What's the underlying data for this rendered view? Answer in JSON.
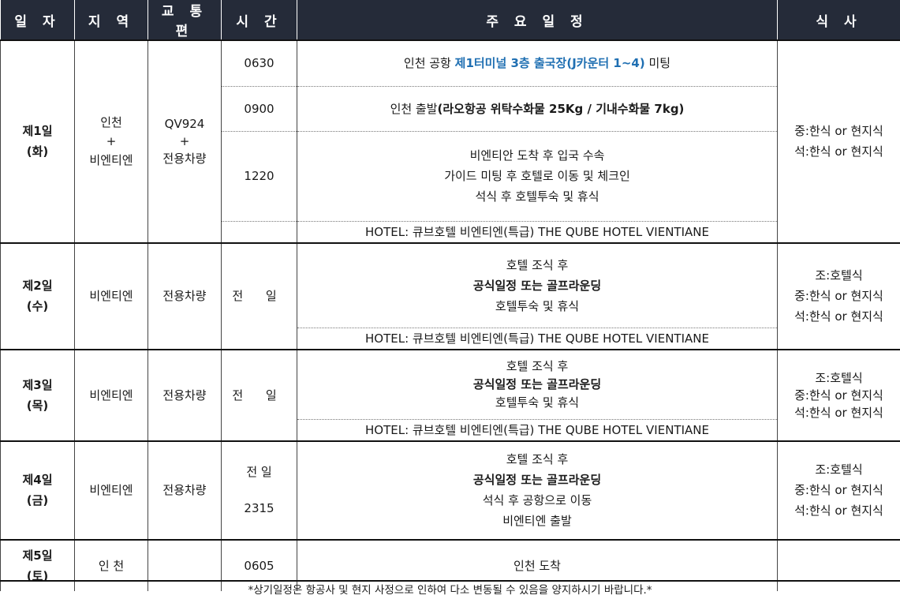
{
  "headers": [
    "일 자",
    "지 역",
    "교 통 편",
    "시 간",
    "주 요 일 정",
    "식 사"
  ],
  "day1": {
    "day": "제1일",
    "weekday": "(화)",
    "region": [
      "인천",
      "+",
      "비엔티엔"
    ],
    "transport": [
      "QV924",
      "+",
      "전용차량"
    ],
    "t1": "0630",
    "s1_pre": "인천 공항 ",
    "s1_hl": "제1터미널 3층 출국장(J카운터 1~4)",
    "s1_post": " 미팅",
    "t2": "0900",
    "s2_pre": "인천 출발",
    "s2_bold": "(라오항공 위탁수화물 25Kg / 기내수화물 7kg)",
    "t3": "1220",
    "s3": [
      "비엔티안 도착 후 입국 수속",
      "가이드 미팅 후 호텔로 이동 및 체크인",
      "석식 후 호텔투숙 및 휴식"
    ],
    "hotel": "HOTEL: 큐브호텔 비엔티엔(특급) THE QUBE HOTEL VIENTIANE",
    "meals": [
      "중:한식 or 현지식",
      "석:한식 or 현지식"
    ]
  },
  "day2": {
    "day": "제2일",
    "weekday": "(수)",
    "region": "비엔티엔",
    "transport": "전용차량",
    "time": "전 일",
    "schedule": [
      "호텔 조식 후",
      "공식일정 또는 골프라운딩",
      "호텔투숙 및 휴식"
    ],
    "hotel": "HOTEL: 큐브호텔 비엔티엔(특급) THE QUBE HOTEL VIENTIANE",
    "meals": [
      "조:호텔식",
      "중:한식 or 현지식",
      "석:한식 or 현지식"
    ]
  },
  "day3": {
    "day": "제3일",
    "weekday": "(목)",
    "region": "비엔티엔",
    "transport": "전용차량",
    "time": "전 일",
    "schedule": [
      "호텔 조식 후",
      "공식일정 또는 골프라운딩",
      "호텔투숙 및 휴식"
    ],
    "hotel": "HOTEL: 큐브호텔 비엔티엔(특급) THE QUBE HOTEL VIENTIANE",
    "meals": [
      "조:호텔식",
      "중:한식 or 현지식",
      "석:한식 or 현지식"
    ]
  },
  "day4": {
    "day": "제4일",
    "weekday": "(금)",
    "region": "비엔티엔",
    "transport": "전용차량",
    "time1": "전 일",
    "time2": "2315",
    "schedule": [
      "호텔 조식 후",
      "공식일정 또는 골프라운딩",
      "석식 후 공항으로 이동",
      "비엔티엔 출발"
    ],
    "meals": [
      "조:호텔식",
      "중:한식 or 현지식",
      "석:한식 or 현지식"
    ]
  },
  "day5": {
    "day": "제5일",
    "weekday": "(토)",
    "region": "인 천",
    "transport": "",
    "time": "0605",
    "schedule": "인천 도착",
    "meals": ""
  },
  "footer": "*상기일정은 항공사 및 현지 사정으로 인하여 다소 변동될 수 있음을 양지하시기 바랍니다.*"
}
